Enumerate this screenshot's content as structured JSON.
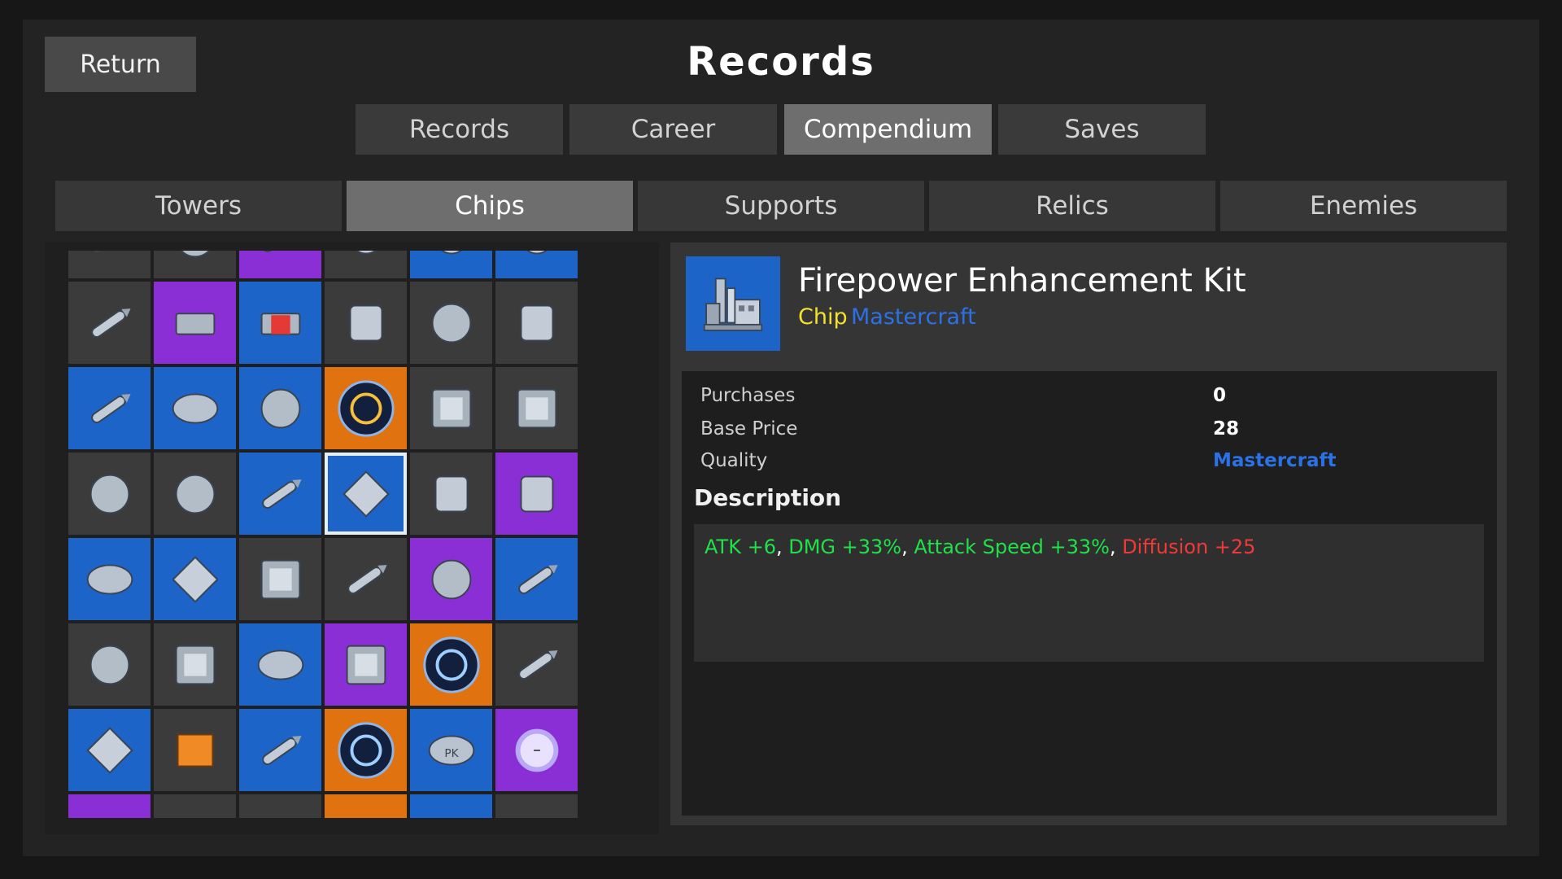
{
  "header": {
    "return_label": "Return",
    "title": "Records"
  },
  "top_tabs": [
    {
      "label": "Records",
      "active": false
    },
    {
      "label": "Career",
      "active": false
    },
    {
      "label": "Compendium",
      "active": true
    },
    {
      "label": "Saves",
      "active": false
    }
  ],
  "category_tabs": [
    {
      "label": "Towers",
      "active": false
    },
    {
      "label": "Chips",
      "active": true
    },
    {
      "label": "Supports",
      "active": false
    },
    {
      "label": "Relics",
      "active": false
    },
    {
      "label": "Enemies",
      "active": false
    }
  ],
  "grid": {
    "rows": [
      [
        "gray",
        "gray",
        "purple",
        "gray",
        "blue",
        "blue"
      ],
      [
        "gray",
        "purple",
        "blue",
        "gray",
        "gray",
        "gray"
      ],
      [
        "blue",
        "blue",
        "blue",
        "orange",
        "gray",
        "gray"
      ],
      [
        "gray",
        "gray",
        "blue",
        "blue-selected",
        "gray",
        "purple"
      ],
      [
        "blue",
        "blue",
        "gray",
        "gray",
        "purple",
        "blue"
      ],
      [
        "gray",
        "gray",
        "blue",
        "purple",
        "orange",
        "gray"
      ],
      [
        "blue",
        "gray",
        "blue",
        "orange",
        "blue",
        "purple"
      ],
      [
        "purple",
        "gray",
        "gray",
        "orange",
        "blue",
        "gray"
      ]
    ],
    "icons": [
      [
        "rod-icon",
        "claw-icon",
        "rod-icon",
        "gear-icon",
        "gear-icon",
        "gear-icon"
      ],
      [
        "bullets-icon",
        "canister-icon",
        "red-core-icon",
        "scope-icon",
        "robot-arm-icon",
        "drone-icon"
      ],
      [
        "missile-icon",
        "module-icon",
        "cube-icon",
        "eclipse-icon",
        "circuit-icon",
        "recycle-chip-icon"
      ],
      [
        "dish-icon",
        "satellite-icon",
        "missile-icon",
        "factory-icon",
        "comet-icon",
        "shell-icon"
      ],
      [
        "signal-icon",
        "fighter-icon",
        "grid-plate-icon",
        "cannon-icon",
        "ship-icon",
        "missile-pair-icon"
      ],
      [
        "connector-icon",
        "mystery-chip-icon",
        "layers-icon",
        "mesh-cube-icon",
        "vortex-icon",
        "needle-icon"
      ],
      [
        "capsule-icon",
        "orange-block-icon",
        "bullet-icon",
        "galaxy-icon",
        "pk-box-icon",
        "orb-icon"
      ],
      [
        "gear-icon",
        "gear-icon",
        "gear-icon",
        "gear-icon",
        "gear-icon",
        "gear-icon"
      ]
    ]
  },
  "detail": {
    "name": "Firepower Enhancement Kit",
    "type_label": "Chip",
    "quality_label": "Mastercraft",
    "icon": "factory-icon",
    "stats": [
      {
        "label": "Purchases",
        "value": "0"
      },
      {
        "label": "Base Price",
        "value": "28"
      },
      {
        "label": "Quality",
        "value": "Mastercraft"
      }
    ],
    "description_heading": "Description",
    "description": [
      {
        "text": "ATK +6",
        "color": "#21e04a"
      },
      {
        "text": ", ",
        "color": "#ffffff"
      },
      {
        "text": "DMG +33%",
        "color": "#21e04a"
      },
      {
        "text": ", ",
        "color": "#ffffff"
      },
      {
        "text": "Attack Speed +33%",
        "color": "#21e04a"
      },
      {
        "text": ", ",
        "color": "#ffffff"
      },
      {
        "text": "Diffusion +25",
        "color": "#f03a3a"
      }
    ]
  },
  "colors": {
    "quality_blue": "#1c64c8",
    "quality_purple": "#8a2fd6",
    "quality_orange": "#e0720f",
    "chip_yellow": "#f3e22a",
    "mastercraft_text": "#2a72e6"
  }
}
